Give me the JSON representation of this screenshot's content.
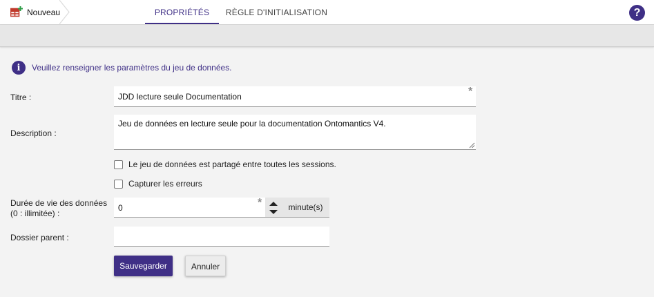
{
  "header": {
    "breadcrumb_label": "Nouveau",
    "breadcrumb_icon": "table-add-icon",
    "tabs": [
      {
        "label": "PROPRIÉTÉS",
        "active": true
      },
      {
        "label": "RÈGLE D'INITIALISATION",
        "active": false
      }
    ],
    "help_icon": "help-circle-icon",
    "help_symbol": "?"
  },
  "colors": {
    "accent": "#3f2f86",
    "icon_red": "#c0392b",
    "icon_green": "#2e9d47"
  },
  "info": {
    "icon": "info-icon",
    "symbol": "i",
    "text": "Veuillez renseigner les paramètres du jeu de données."
  },
  "form": {
    "title_label": "Titre :",
    "title_value": "JDD lecture seule Documentation",
    "title_required": "*",
    "description_label": "Description :",
    "description_value": "Jeu de données en lecture seule pour la documentation Ontomantics V4.",
    "shared_label": "Le jeu de données est partagé entre toutes les sessions.",
    "shared_checked": false,
    "capture_label": "Capturer les erreurs",
    "capture_checked": false,
    "lifetime_label_line1": "Durée de vie des données",
    "lifetime_label_line2": "(0 : illimitée) :",
    "lifetime_value": "0",
    "lifetime_required": "*",
    "lifetime_unit": "minute(s)",
    "parent_label": "Dossier parent :",
    "parent_value": ""
  },
  "actions": {
    "save_label": "Sauvegarder",
    "cancel_label": "Annuler"
  }
}
